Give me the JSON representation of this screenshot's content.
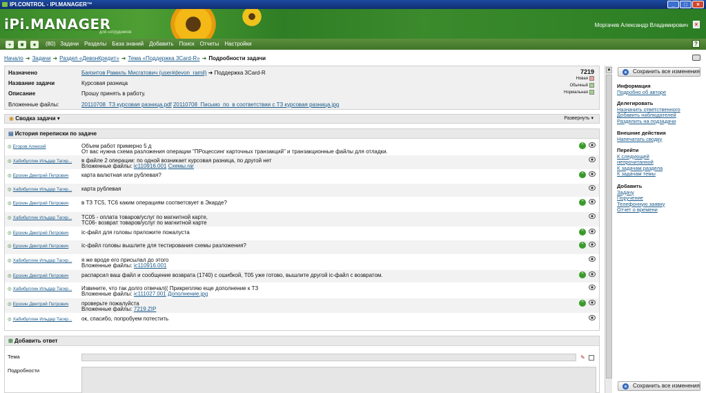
{
  "window": {
    "title": "IPI.CONTROL - IPI.MANAGER™"
  },
  "header": {
    "logo": "iPi.MANAGER",
    "logo_sub": "для сотрудников",
    "user": "Моргачев Александр Владимирович"
  },
  "menu": {
    "count": "(80)",
    "items": [
      "Задачи",
      "Разделы",
      "База знаний",
      "Добавить",
      "Поиск",
      "Отчеты",
      "Настройки"
    ]
  },
  "breadcrumbs": [
    "Начало",
    "Задачи",
    "Раздел «ДевонКредит»",
    "Тема «Поддержка 3Card-R»",
    "Подробности задачи"
  ],
  "task": {
    "assigned_label": "Назначено",
    "assigned_user": "Баязитов Рамиль Мисгатович (user#devon_ramil)",
    "assigned_rest": "Поддержка 3Card-R",
    "name_label": "Название задачи",
    "name": "Курсовая разница",
    "desc_label": "Описание",
    "desc": "Прошу принять в работу.",
    "files_label": "Вложенные файлы:",
    "files": [
      "20110708_ТЗ курсовая разница.pdf",
      "20110708_Письмо_по_в соответствии с ТЗ курсовая разница.jpg"
    ],
    "number": "7219",
    "status": "Новая",
    "type": "Обычный",
    "priority": "Нормальная",
    "status_color": "#e8a0a0",
    "type_color": "#9fd28a",
    "priority_color": "#9fd28a"
  },
  "summary": {
    "label": "Сводка задачи",
    "expand": "Развернуть"
  },
  "history": {
    "label": "История переписки по задаче",
    "messages": [
      {
        "author": "Егоров Алексей",
        "lines": [
          "Объем работ примерно 5 д",
          "От вас нужна схема разложения операции \"ПРоцессинг карточных транзакций\" и транзакционные файлы для отладки."
        ],
        "files": []
      },
      {
        "author": "Хабибуллин Ильдар Тагир...",
        "lines": [
          "в файле 2 операции: по одной возникает курсовая разница, по другой нет"
        ],
        "files_label": "Вложенные файлы:",
        "files": [
          "ic110916.001",
          "Схемы.rar"
        ]
      },
      {
        "author": "Ерохин Дмитрий Петрович",
        "lines": [
          "карта валютная или рублевая?"
        ],
        "files": []
      },
      {
        "author": "Хабибуллин Ильдар Тагир...",
        "lines": [
          "карта рублевая"
        ],
        "files": []
      },
      {
        "author": "Ерохин Дмитрий Петрович",
        "lines": [
          "в ТЗ ТС5, ТС6 каким операциям соответсвует в Экарде?"
        ],
        "files": []
      },
      {
        "author": "Хабибуллин Ильдар Тагир...",
        "lines": [
          "ТС05 - оплата товаров/услуг по магнитной карте,",
          "ТС06- возврат товаров/услуг по магнитной карте"
        ],
        "files": []
      },
      {
        "author": "Ерохин Дмитрий Петрович",
        "lines": [
          "ic-файл для головы приложите пожалуста"
        ],
        "files": []
      },
      {
        "author": "Ерохин Дмитрий Петрович",
        "lines": [
          "ic-файл головы вышлите для тестирования схемы разложения?"
        ],
        "files": []
      },
      {
        "author": "Хабибуллин Ильдар Тагир...",
        "lines": [
          "я же вроде его присылал до этого"
        ],
        "files_label": "Вложенные файлы:",
        "files": [
          "ic110916.001"
        ]
      },
      {
        "author": "Ерохин Дмитрий Петрович",
        "lines": [
          "распарсил ваш файл и сообщение возврата (1740) с ошибкой, Т05 уже готово, вышлите другой ic-файл с возвратом."
        ],
        "files": []
      },
      {
        "author": "Хабибуллин Ильдар Тагир...",
        "lines": [
          "Извините, что так долго отвечал(( Прикрепляю еще дополнение к ТЗ"
        ],
        "files_label": "Вложенные файлы:",
        "files": [
          "ic111027.001",
          "Дополнение.jpg"
        ]
      },
      {
        "author": "Ерохин Дмитрий Петрович",
        "lines": [
          "проверьте пожалуйста"
        ],
        "files_label": "Вложенные файлы:",
        "files": [
          "7219.ZIP"
        ]
      },
      {
        "author": "Хабибуллин Ильдар Тагир...",
        "lines": [
          "ок, спасибо, попробуем потестить"
        ],
        "files": []
      }
    ]
  },
  "reply": {
    "label": "Добавить ответ",
    "topic_label": "Тема",
    "details_label": "Подробности"
  },
  "sidebar": {
    "save_label": "Сохранить все изменения",
    "groups": [
      {
        "title": "Информация",
        "links": [
          "Подробно об авторе"
        ]
      },
      {
        "title": "Делегировать",
        "links": [
          "Назначить ответственного",
          "Добавить наблюдателей",
          "Разделить на подзадачи"
        ]
      },
      {
        "title": "Внешние действия",
        "links": [
          "Напечатать сводку"
        ]
      },
      {
        "title": "Перейти",
        "links": [
          "К следующей",
          "непрочитанной",
          "К задачам раздела",
          "К задачам темы"
        ]
      },
      {
        "title": "Добавить",
        "links": [
          "Задачу",
          "Поручение",
          "Телефонную заявку",
          "Отчет о времени"
        ]
      }
    ]
  }
}
